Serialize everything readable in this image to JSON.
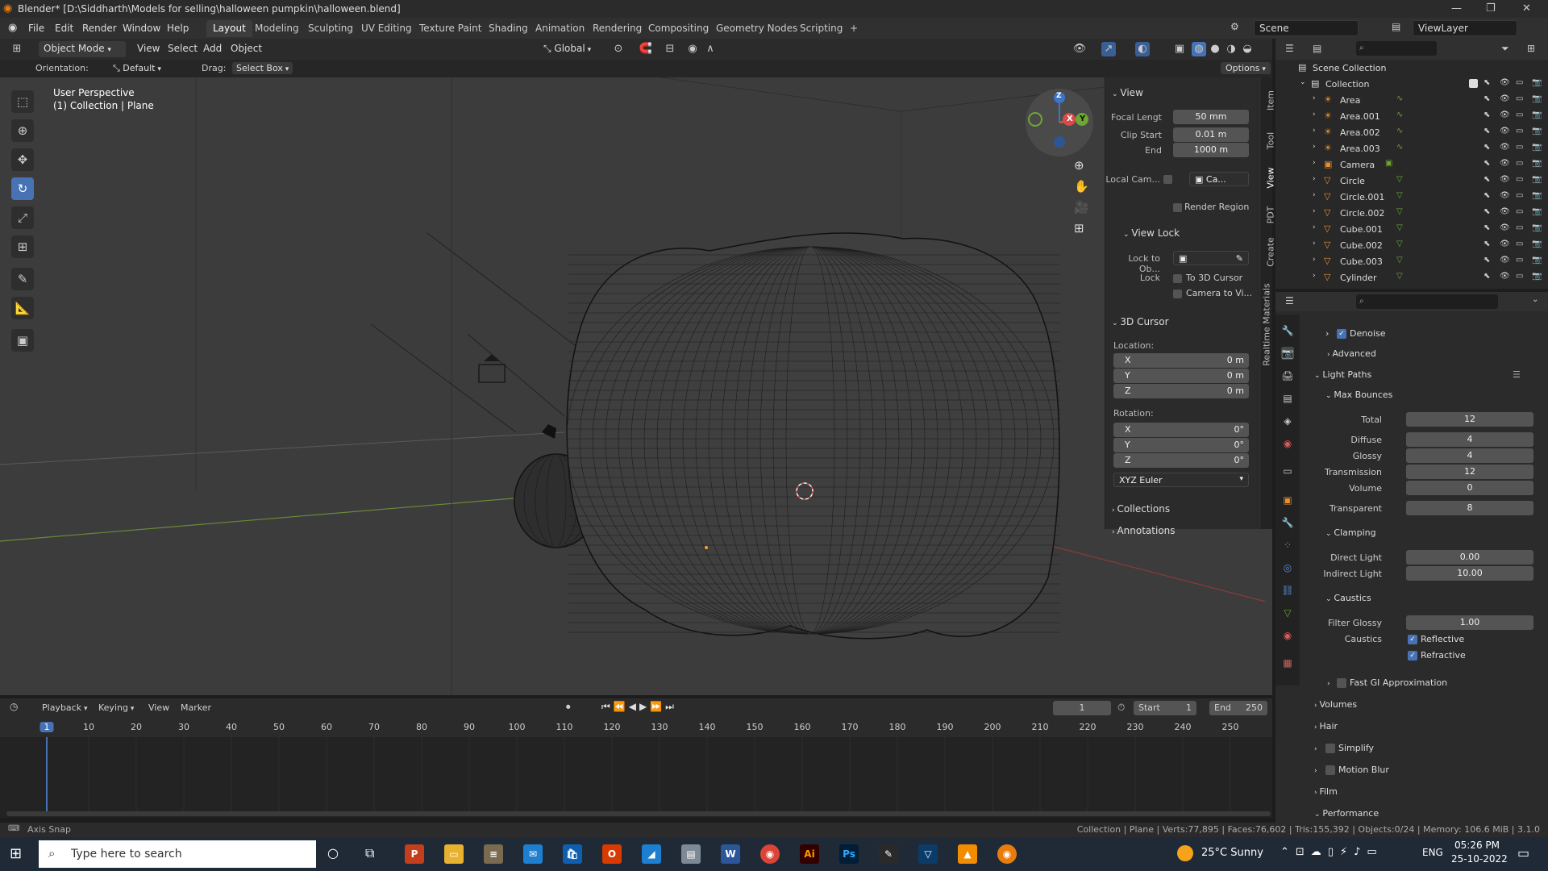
{
  "window": {
    "title": "Blender* [D:\\Siddharth\\Models for selling\\halloween pumpkin\\halloween.blend]",
    "minimize": "—",
    "maximize": "❐",
    "close": "✕"
  },
  "menubar": {
    "items": [
      "File",
      "Edit",
      "Render",
      "Window",
      "Help"
    ],
    "workspaces": [
      "Layout",
      "Modeling",
      "Sculpting",
      "UV Editing",
      "Texture Paint",
      "Shading",
      "Animation",
      "Rendering",
      "Compositing",
      "Geometry Nodes",
      "Scripting"
    ],
    "add_tab": "+",
    "scene": "Scene",
    "view_layer": "ViewLayer"
  },
  "viewport_header": {
    "mode": "Object Mode",
    "menus": [
      "View",
      "Select",
      "Add",
      "Object"
    ],
    "transform": "Global"
  },
  "tool_header": {
    "orientation_label": "Orientation:",
    "orientation_value": "Default",
    "drag_label": "Drag:",
    "drag_value": "Select Box",
    "options": "Options"
  },
  "viewport": {
    "perspective": "User Perspective",
    "collection": "(1) Collection | Plane"
  },
  "gizmo": {
    "z": "Z",
    "x": "X",
    "y": "Y"
  },
  "npanel": {
    "view_title": "View",
    "focal_label": "Focal Lengt",
    "focal_value": "50 mm",
    "clip_start_label": "Clip Start",
    "clip_start_value": "0.01 m",
    "end_label": "End",
    "end_value": "1000 m",
    "local_cam_label": "Local Cam...",
    "local_cam_value": "Ca...",
    "render_region": "Render Region",
    "view_lock": "View Lock",
    "lock_to_ob": "Lock to Ob...",
    "lock_label": "Lock",
    "to_3d_cursor": "To 3D Cursor",
    "camera_to_view": "Camera to Vi...",
    "cursor_title": "3D Cursor",
    "location_label": "Location:",
    "loc_x": "0 m",
    "loc_y": "0 m",
    "loc_z": "0 m",
    "rotation_label": "Rotation:",
    "rot_x": "0°",
    "rot_y": "0°",
    "rot_z": "0°",
    "axis_x": "X",
    "axis_y": "Y",
    "axis_z": "Z",
    "rot_mode": "XYZ Euler",
    "collections": "Collections",
    "annotations": "Annotations",
    "tabs": [
      "Item",
      "Tool",
      "View",
      "PDT",
      "Create",
      "Realtime Materials"
    ]
  },
  "outliner": {
    "scene_collection": "Scene Collection",
    "collection": "Collection",
    "objects": [
      "Area",
      "Area.001",
      "Area.002",
      "Area.003",
      "Camera",
      "Circle",
      "Circle.001",
      "Circle.002",
      "Cube.001",
      "Cube.002",
      "Cube.003",
      "Cylinder"
    ]
  },
  "properties": {
    "denoise": "Denoise",
    "advanced": "Advanced",
    "light_paths": "Light Paths",
    "max_bounces": "Max Bounces",
    "total_label": "Total",
    "total": "12",
    "diffuse_label": "Diffuse",
    "diffuse": "4",
    "glossy_label": "Glossy",
    "glossy": "4",
    "transmission_label": "Transmission",
    "transmission": "12",
    "volume_label": "Volume",
    "volume": "0",
    "transparent_label": "Transparent",
    "transparent": "8",
    "clamping": "Clamping",
    "direct_label": "Direct Light",
    "direct": "0.00",
    "indirect_label": "Indirect Light",
    "indirect": "10.00",
    "caustics_head": "Caustics",
    "filter_glossy_label": "Filter Glossy",
    "filter_glossy": "1.00",
    "caustics_label": "Caustics",
    "reflective": "Reflective",
    "refractive": "Refractive",
    "fast_gi": "Fast GI Approximation",
    "volumes": "Volumes",
    "hair": "Hair",
    "simplify": "Simplify",
    "motion_blur": "Motion Blur",
    "film": "Film",
    "performance": "Performance"
  },
  "timeline": {
    "menus": [
      "Playback",
      "Keying",
      "View",
      "Marker"
    ],
    "current_frame": "1",
    "start_label": "Start",
    "start": "1",
    "end_label": "End",
    "end": "250",
    "ticks": [
      "1",
      "10",
      "20",
      "30",
      "40",
      "50",
      "60",
      "70",
      "80",
      "90",
      "100",
      "110",
      "120",
      "130",
      "140",
      "150",
      "160",
      "170",
      "180",
      "190",
      "200",
      "210",
      "220",
      "230",
      "240",
      "250"
    ]
  },
  "statusbar": {
    "left": "Axis Snap",
    "right": "Collection | Plane | Verts:77,895 | Faces:76,602 | Tris:155,392 | Objects:0/24 | Memory: 106.6 MiB | 3.1.0"
  },
  "taskbar": {
    "search_placeholder": "Type here to search",
    "weather": "25°C  Sunny",
    "lang": "ENG",
    "time": "05:26 PM",
    "date": "25-10-2022"
  },
  "colors": {
    "accent": "#4772b3",
    "viewport_bg": "#3c3c3c",
    "panel_bg": "#2b2b2b"
  }
}
